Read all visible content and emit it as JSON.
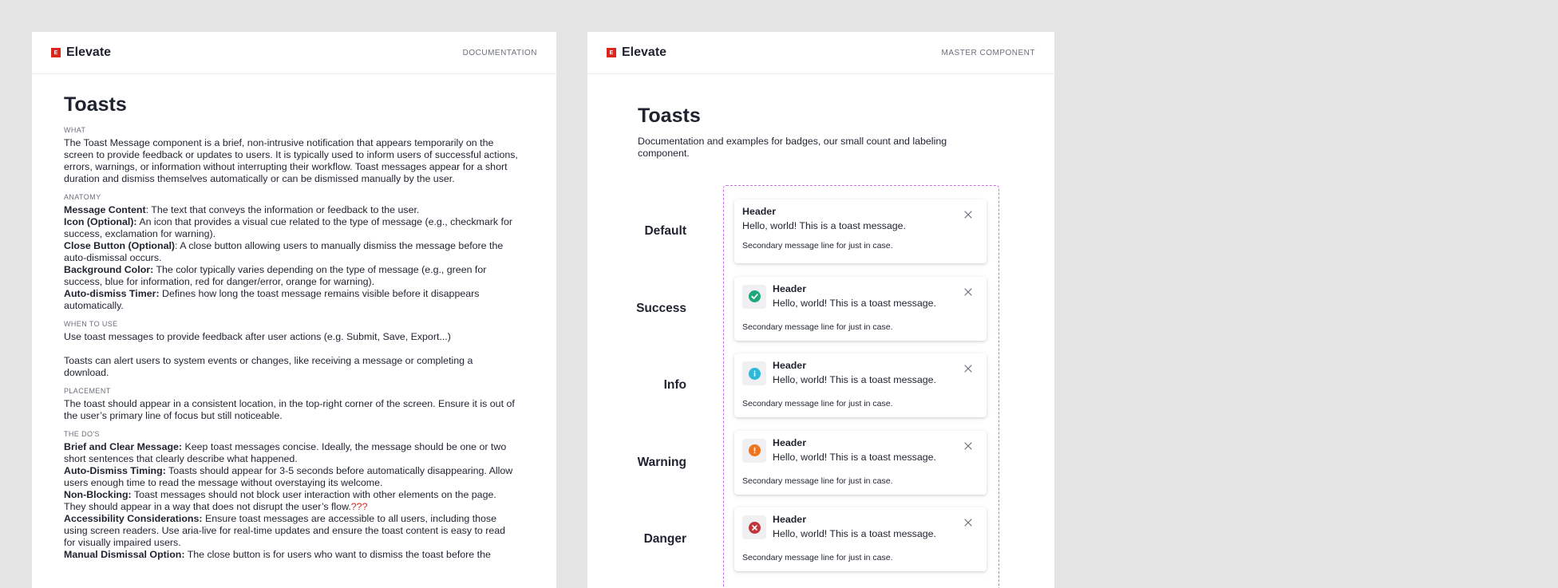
{
  "doc": {
    "brand": "Elevate",
    "tag": "DOCUMENTATION",
    "title": "Toasts",
    "what_label": "WHAT",
    "what_text": "The Toast Message component is a brief, non-intrusive notification that appears temporarily on the screen to provide feedback or updates to users. It is typically used to inform users of successful actions, errors, warnings, or information without interrupting their workflow. Toast messages appear for a short duration and dismiss themselves automatically or can be dismissed manually by the user.",
    "anatomy_label": "ANATOMY",
    "anatomy": [
      {
        "term": "Message Content",
        "sep": ": ",
        "text": "The text that conveys the information or feedback to the user."
      },
      {
        "term": "Icon (Optional):",
        "sep": " ",
        "text": "An icon that provides a visual cue related to the type of message (e.g., checkmark for success, exclamation for warning)."
      },
      {
        "term": "Close Button (Optional)",
        "sep": ": ",
        "text": "A close button allowing users to manually dismiss the message before the auto-dismissal occurs."
      },
      {
        "term": "Background Color:",
        "sep": " ",
        "text": "The color typically varies depending on the type of message (e.g., green for success, blue for information, red for danger/error, orange for warning)."
      },
      {
        "term": "Auto-dismiss Timer:",
        "sep": " ",
        "text": "Defines how long the toast message remains visible before it disappears automatically."
      }
    ],
    "when_label": "WHEN TO USE",
    "when_1": "Use toast messages to provide feedback after user actions (e.g. Submit, Save, Export...)",
    "when_2": "Toasts can alert users to system events or changes, like receiving a message or completing a download.",
    "placement_label": "PLACEMENT",
    "placement_text": "The toast should appear in a consistent location, in the top-right corner of the screen. Ensure it is out of the user’s primary line of focus but still noticeable.",
    "dos_label": "THE DO'S",
    "dos": [
      {
        "term": "Brief and Clear Message:",
        "text": "Keep toast messages concise. Ideally, the message should be one or two short sentences that clearly describe what happened."
      },
      {
        "term": "Auto-Dismiss Timing:",
        "text": "Toasts should appear for 3-5 seconds before automatically disappearing. Allow users enough time to read the message without overstaying its welcome."
      },
      {
        "term": "Non-Blocking:",
        "text": "Toast messages should not block user interaction with other elements on the page. They should appear in a way that does not disrupt the user’s flow.",
        "flag": "???"
      },
      {
        "term": "Accessibility Considerations:",
        "text": "Ensure toast messages are accessible to all users, including those using screen readers. Use aria-live for real-time updates and ensure the toast content is easy to read for visually impaired users."
      },
      {
        "term": "Manual Dismissal Option:",
        "text": "The close button is for users who want to dismiss the toast before the"
      }
    ]
  },
  "master": {
    "brand": "Elevate",
    "tag": "MASTER COMPONENT",
    "title": "Toasts",
    "description": "Documentation and examples for badges, our small count and labeling component.",
    "toasts": [
      {
        "label": "Default",
        "header": "Header",
        "message": "Hello, world! This is a toast message.",
        "secondary": "Secondary message line for just in case.",
        "icon": null,
        "color": null
      },
      {
        "label": "Success",
        "header": "Header",
        "message": "Hello, world! This is a toast message.",
        "secondary": "Secondary message line for just in case.",
        "icon": "check-circle-icon",
        "color": "#1fa97a"
      },
      {
        "label": "Info",
        "header": "Header",
        "message": "Hello, world! This is a toast message.",
        "secondary": "Secondary message line for just in case.",
        "icon": "info-circle-icon",
        "color": "#2fb8d8"
      },
      {
        "label": "Warning",
        "header": "Header",
        "message": "Hello, world! This is a toast message.",
        "secondary": "Secondary message line for just in case.",
        "icon": "exclamation-circle-icon",
        "color": "#ef7420"
      },
      {
        "label": "Danger",
        "header": "Header",
        "message": "Hello, world! This is a toast message.",
        "secondary": "Secondary message line for just in case.",
        "icon": "x-circle-icon",
        "color": "#c0363a"
      }
    ]
  },
  "colors": {
    "brand": "#d9271d",
    "frame": "#c86fe8",
    "flag": "#d9271d"
  }
}
